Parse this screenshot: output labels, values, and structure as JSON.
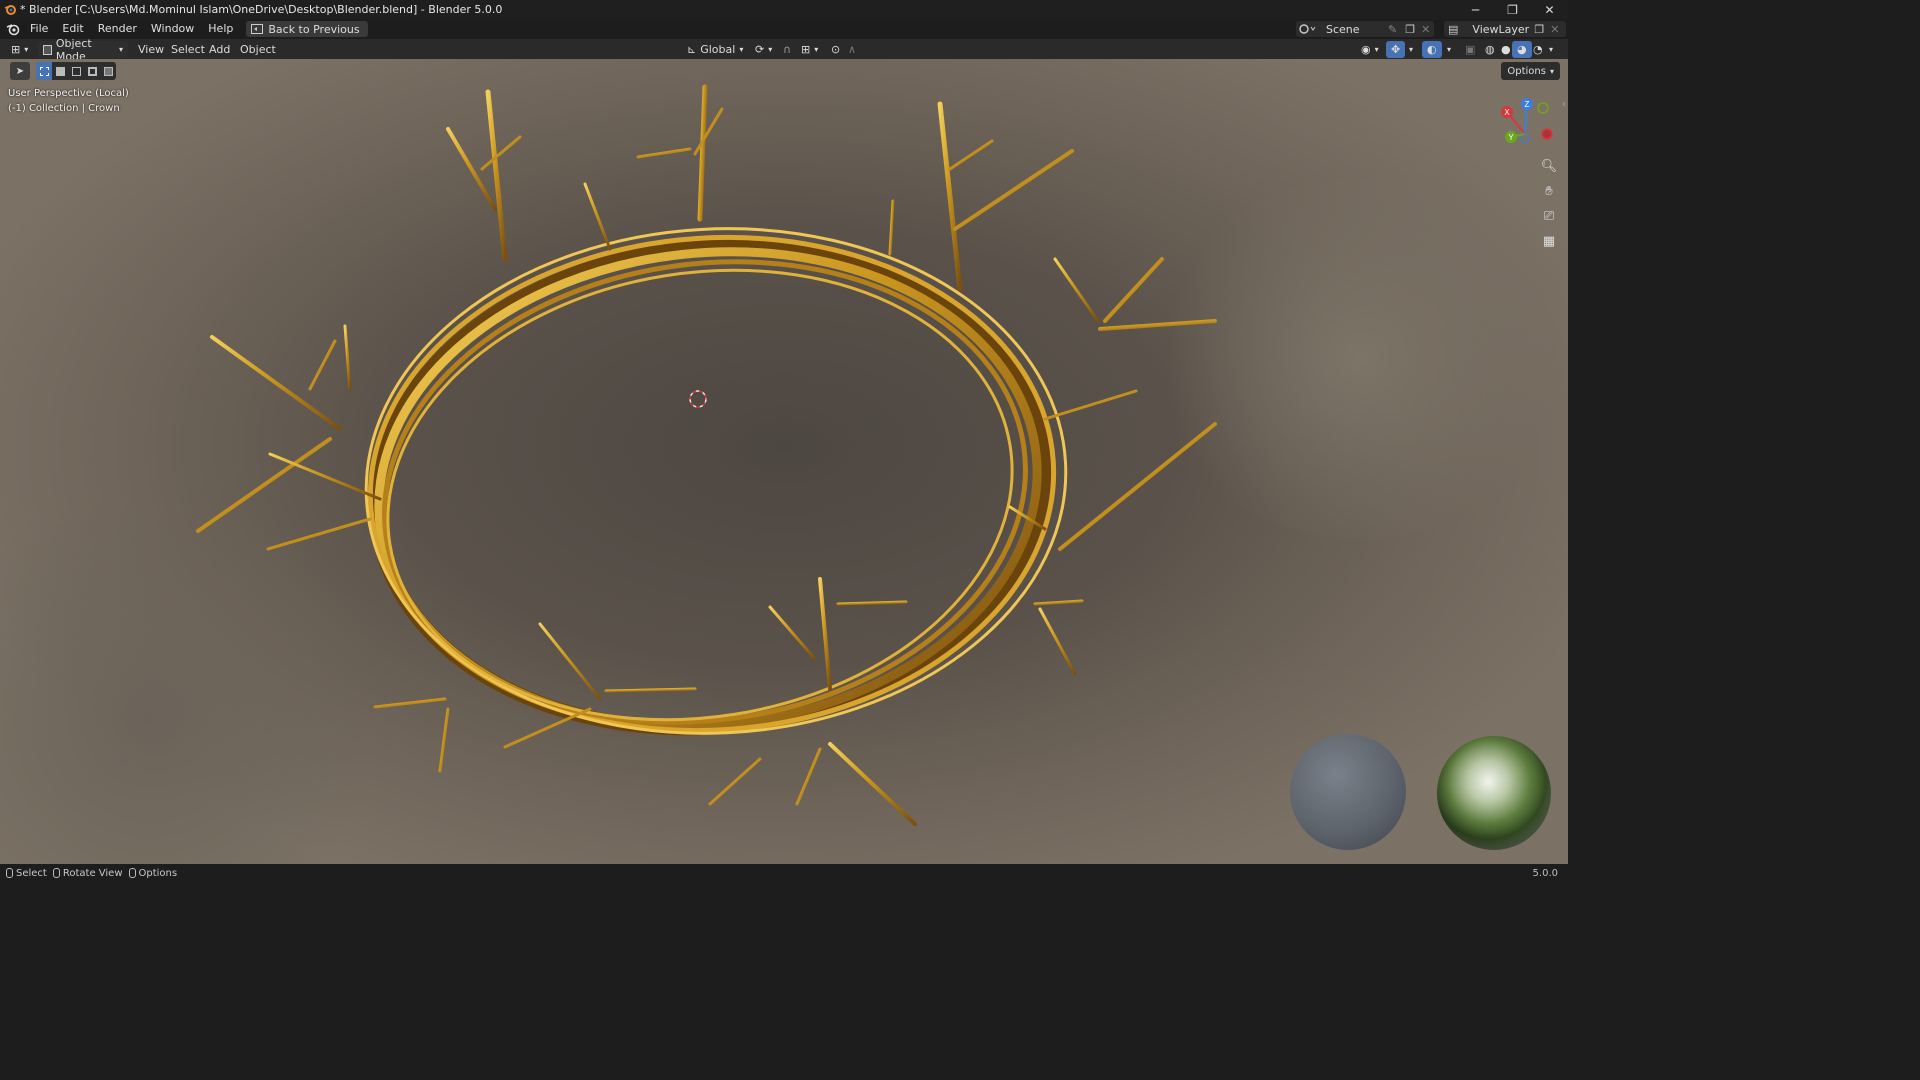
{
  "window": {
    "title": "* Blender [C:\\Users\\Md.Mominul Islam\\OneDrive\\Desktop\\Blender.blend] - Blender 5.0.0",
    "minimize_glyph": "─",
    "maximize_glyph": "❐",
    "close_glyph": "✕"
  },
  "menubar": {
    "items": [
      "File",
      "Edit",
      "Render",
      "Window",
      "Help"
    ],
    "back_button": "Back to Previous",
    "scene_label": "Scene",
    "viewlayer_label": "ViewLayer"
  },
  "header": {
    "mode": "Object Mode",
    "menus": [
      "View",
      "Select",
      "Add",
      "Object"
    ],
    "transform_orientation": "Global"
  },
  "viewport": {
    "options_label": "Options",
    "perspective": "User Perspective (Local)",
    "collection": "(-1) Collection | Crown",
    "gizmo": {
      "x": "X",
      "y": "Y",
      "z": "Z"
    },
    "colors": {
      "x_axis": "#d6383f",
      "y_axis": "#6aa71e",
      "z_axis": "#3c7fe0",
      "crown_gold": "#c9951f"
    }
  },
  "statusbar": {
    "items": [
      "Select",
      "Rotate View",
      "Options"
    ],
    "version": "5.0.0"
  }
}
